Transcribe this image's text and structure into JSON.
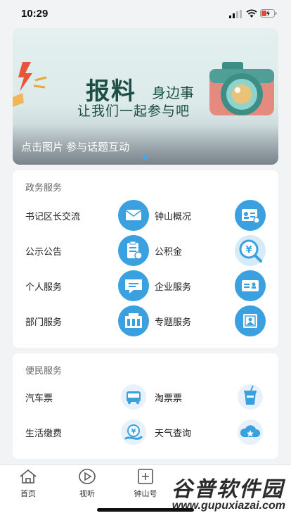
{
  "status_bar": {
    "time": "10:29"
  },
  "banner": {
    "title_main": "报料",
    "title_side": "身边事",
    "title_sub": "让我们一起参与吧",
    "caption": "点击图片 参与话题互动"
  },
  "gov_services": {
    "title": "政务服务",
    "items": [
      {
        "label": "书记区长交流",
        "icon": "mail-icon"
      },
      {
        "label": "钟山概况",
        "icon": "id-card-icon"
      },
      {
        "label": "公示公告",
        "icon": "notice-board-icon"
      },
      {
        "label": "公积金",
        "icon": "yuan-search-icon"
      },
      {
        "label": "个人服务",
        "icon": "chat-bubble-icon"
      },
      {
        "label": "企业服务",
        "icon": "business-card-icon"
      },
      {
        "label": "部门服务",
        "icon": "building-icon"
      },
      {
        "label": "专题服务",
        "icon": "picture-frame-icon"
      }
    ]
  },
  "public_services": {
    "title": "便民服务",
    "items": [
      {
        "label": "汽车票",
        "icon": "bus-icon"
      },
      {
        "label": "淘票票",
        "icon": "drink-cup-icon"
      },
      {
        "label": "生活缴费",
        "icon": "payment-icon"
      },
      {
        "label": "天气查询",
        "icon": "weather-cloud-icon"
      }
    ]
  },
  "tab_bar": {
    "items": [
      {
        "label": "首页",
        "icon": "home-icon"
      },
      {
        "label": "视听",
        "icon": "play-icon"
      },
      {
        "label": "钟山号",
        "icon": "plus-square-icon"
      }
    ]
  },
  "watermark": {
    "text": "谷普软件园",
    "url": "www.gupuxiazai.com"
  },
  "colors": {
    "icon_blue": "#3aa0e0",
    "icon_circle": "#d6ebf8",
    "card_bg": "#ffffff",
    "page_bg": "#f2f3f5"
  }
}
